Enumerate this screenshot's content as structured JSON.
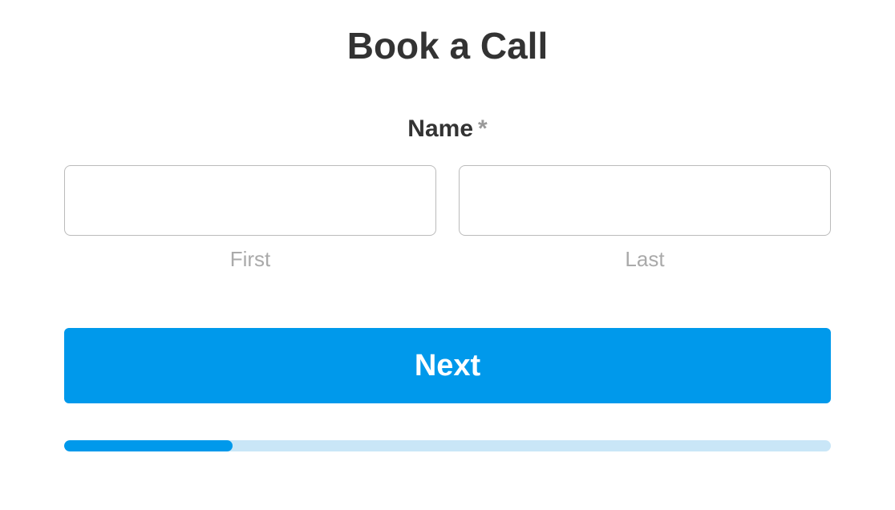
{
  "title": "Book a Call",
  "form": {
    "name_label": "Name",
    "required_marker": "*",
    "first": {
      "value": "",
      "sub_label": "First"
    },
    "last": {
      "value": "",
      "sub_label": "Last"
    },
    "next_button_label": "Next"
  },
  "progress": {
    "percent": 22
  },
  "colors": {
    "accent": "#0099eb",
    "progress_track": "#c9e6f7",
    "text_primary": "#333333",
    "text_muted": "#aaaaaa",
    "border": "#bbbbbb"
  }
}
